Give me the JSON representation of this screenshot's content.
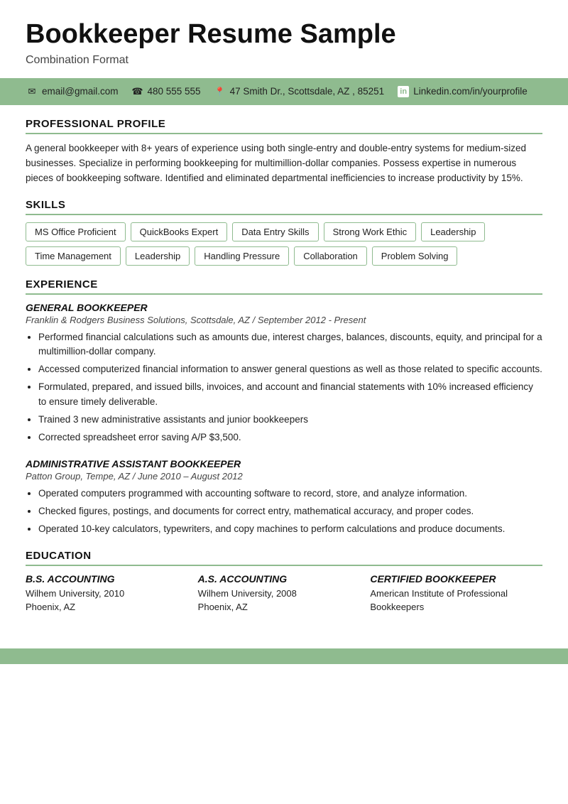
{
  "header": {
    "title": "Bookkeeper Resume Sample",
    "subtitle": "Combination Format"
  },
  "contact": {
    "email": "email@gmail.com",
    "phone": "480 555 555",
    "address": "47 Smith Dr., Scottsdale, AZ , 85251",
    "linkedin": "Linkedin.com/in/yourprofile"
  },
  "sections": {
    "professional_profile": {
      "label": "PROFESSIONAL PROFILE",
      "text": "A general bookkeeper with 8+ years of experience using both single-entry and double-entry systems for medium-sized businesses. Specialize in performing bookkeeping for multimillion-dollar companies. Possess expertise in numerous pieces of bookkeeping software. Identified and eliminated departmental inefficiencies to increase productivity by 15%."
    },
    "skills": {
      "label": "SKILLS",
      "items": [
        "MS Office Proficient",
        "QuickBooks Expert",
        "Data Entry Skills",
        "Strong Work Ethic",
        "Leadership",
        "Time Management",
        "Leadership",
        "Handling Pressure",
        "Collaboration",
        "Problem Solving"
      ]
    },
    "experience": {
      "label": "EXPERIENCE",
      "jobs": [
        {
          "title": "GENERAL BOOKKEEPER",
          "company": "Franklin & Rodgers Business Solutions, Scottsdale, AZ  /  September 2012 - Present",
          "bullets": [
            "Performed financial calculations such as amounts due, interest charges, balances, discounts, equity, and principal for a multimillion-dollar company.",
            "Accessed computerized financial information to answer general questions as well as those related to specific accounts.",
            "Formulated, prepared, and issued bills, invoices, and account and financial statements with 10% increased efficiency to ensure timely deliverable.",
            "Trained 3 new administrative assistants and junior bookkeepers",
            "Corrected spreadsheet error saving A/P $3,500."
          ]
        },
        {
          "title": "ADMINISTRATIVE ASSISTANT BOOKKEEPER",
          "company": "Patton Group, Tempe, AZ  /  June 2010 – August 2012",
          "bullets": [
            "Operated computers programmed with accounting software to record, store, and analyze information.",
            "Checked figures, postings, and documents for correct entry, mathematical accuracy, and proper codes.",
            "Operated 10-key calculators, typewriters, and copy machines to perform calculations and produce documents."
          ]
        }
      ]
    },
    "education": {
      "label": "EDUCATION",
      "items": [
        {
          "title": "B.S. ACCOUNTING",
          "details": [
            "Wilhem University, 2010",
            "Phoenix, AZ"
          ]
        },
        {
          "title": "A.S. ACCOUNTING",
          "details": [
            "Wilhem University, 2008",
            "Phoenix, AZ"
          ]
        },
        {
          "title": "CERTIFIED BOOKKEEPER",
          "details": [
            "American Institute of Professional Bookkeepers"
          ]
        }
      ]
    }
  }
}
